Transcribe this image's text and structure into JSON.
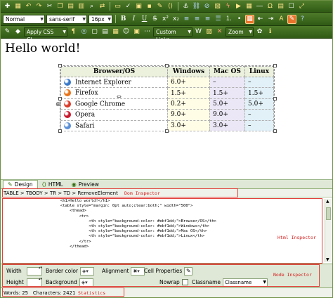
{
  "toolbar": {
    "row1_icons": [
      "new-icon",
      "grid-icon",
      "undo-icon",
      "redo-icon",
      "cut-icon",
      "copy-icon",
      "paste-icon",
      "paste-text-icon",
      "find-icon",
      "replace-icon",
      "print-icon",
      "spell-icon",
      "preview-icon",
      "save-icon",
      "clean-icon",
      "code-icon",
      "anchor-icon",
      "link-icon",
      "unlink-icon",
      "image-icon",
      "flash-icon",
      "media-icon",
      "table-icon",
      "hr-icon",
      "special-char-icon",
      "template-icon",
      "form-icon",
      "fullscreen-icon"
    ],
    "format_value": "Normal",
    "font_value": "sans-serif",
    "size_value": "16px",
    "bold": "B",
    "italic": "I",
    "underline": "U",
    "css_class_value": "Apply CSS Cl...",
    "links_value": "Custom Links",
    "zoom_value": "Zoom"
  },
  "editor": {
    "heading": "Hello world!",
    "table": {
      "headers": [
        "Browser/OS",
        "Windows",
        "Mac OS",
        "Linux"
      ],
      "rows": [
        {
          "browser": "Internet Explorer",
          "icon": "ie-icon",
          "color": "#3a78c9",
          "win": "6.0+",
          "mac": "–",
          "linux": "–"
        },
        {
          "browser": "Firefox",
          "icon": "firefox-icon",
          "color": "#e8741a",
          "win": "1.5+",
          "mac": "1.5+",
          "linux": "1.5+"
        },
        {
          "browser": "Google Chrome",
          "icon": "chrome-icon",
          "color": "#d93b2b",
          "win": "0.2+",
          "mac": "5.0+",
          "linux": "5.0+"
        },
        {
          "browser": "Opera",
          "icon": "opera-icon",
          "color": "#c8172b",
          "win": "9.0+",
          "mac": "9.0+",
          "linux": "–"
        },
        {
          "browser": "Safari",
          "icon": "safari-icon",
          "color": "#5b8fd6",
          "win": "3.0+",
          "mac": "3.0+",
          "linux": "–"
        }
      ]
    }
  },
  "tabs": [
    {
      "label": "Design"
    },
    {
      "label": "HTML"
    },
    {
      "label": "Preview"
    }
  ],
  "dom": {
    "path": "TABLE > TBODY > TR > TD > RemoveElement",
    "annotation": "Dom Inspector"
  },
  "html_inspector": {
    "annotation": "Html Inspector",
    "lines": [
      "                        <h1>Hello world!</h1>",
      "                        <table style=\"margin: 0pt auto;clear:both;\" width=\"500\">",
      "                            <thead>",
      "                                <tr>",
      "                                    <th style=\"background-color: #ebf1dd;\">Browser/OS</th>",
      "                                    <th style=\"background-color: #ebf1dd;\">Windows</th>",
      "                                    <th style=\"background-color: #ebf1dd;\">Mac OS</th>",
      "                                    <th style=\"background-color: #ebf1dd;\">Linux</th>",
      "                                </tr>",
      "                            </thead>"
    ]
  },
  "node_inspector": {
    "annotation": "Node Inspector",
    "width_label": "Width",
    "height_label": "Height",
    "border_color_label": "Border color",
    "background_label": "Background",
    "alignment_label": "Alignment",
    "nowrap_label": "Nowrap",
    "cell_properties_label": "Cell Properties",
    "classname_label": "Classname",
    "classname_value": "Classname"
  },
  "status": {
    "words": "Words: 25",
    "characters": "Characters: 2421",
    "annotation": "Statistics"
  },
  "colors": {
    "toolbar": "#3d6a1d",
    "header_bg": "#ebf1dd",
    "annotation": "#d21a1a"
  }
}
